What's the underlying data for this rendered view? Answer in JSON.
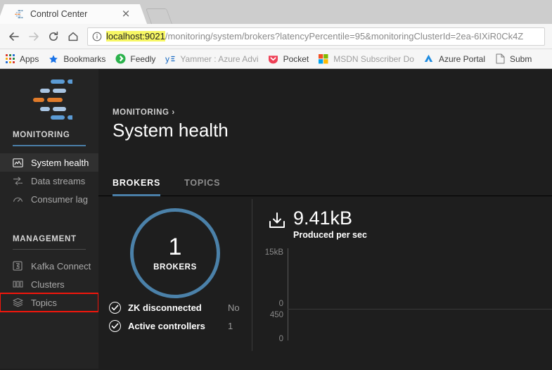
{
  "browser": {
    "tab": {
      "title": "Control Center",
      "favicon": "confluent-logo-icon",
      "close": "×"
    },
    "new_tab_label": "new-tab",
    "nav": {
      "back": "←",
      "forward": "→",
      "reload": "↻",
      "home": "⌂"
    },
    "omnibox": {
      "info_icon": "info-circle-icon",
      "host": "localhost:9021",
      "path": "/monitoring/system/brokers?latencyPercentile=95&monitoringClusterId=2ea-6IXiR0Ck4Z"
    },
    "bookmarks": [
      {
        "label": "Apps",
        "icon": "apps-grid-icon"
      },
      {
        "label": "Bookmarks",
        "icon": "star-icon"
      },
      {
        "label": "Feedly",
        "icon": "feedly-icon"
      },
      {
        "label": "Yammer : Azure Advi",
        "icon": "yammer-icon",
        "faded": true
      },
      {
        "label": "Pocket",
        "icon": "pocket-icon"
      },
      {
        "label": "MSDN Subscriber Do",
        "icon": "microsoft-icon",
        "faded": true
      },
      {
        "label": "Azure Portal",
        "icon": "azure-icon"
      },
      {
        "label": "Subm",
        "icon": "page-icon"
      }
    ]
  },
  "sidebar": {
    "logo": "confluent-control-center-logo",
    "sections": [
      {
        "title": "MONITORING",
        "accent": "#4a7fa8",
        "items": [
          {
            "label": "System health",
            "icon": "system-health-icon",
            "active": true
          },
          {
            "label": "Data streams",
            "icon": "data-streams-icon",
            "active": false
          },
          {
            "label": "Consumer lag",
            "icon": "consumer-lag-icon",
            "active": false
          }
        ]
      },
      {
        "title": "MANAGEMENT",
        "accent": "#4a4a4a",
        "items": [
          {
            "label": "Kafka Connect",
            "icon": "kafka-connect-icon",
            "active": false
          },
          {
            "label": "Clusters",
            "icon": "clusters-icon",
            "active": false
          },
          {
            "label": "Topics",
            "icon": "topics-icon",
            "active": false,
            "highlight": true
          }
        ]
      }
    ]
  },
  "main": {
    "breadcrumb": "MONITORING",
    "breadcrumb_chevron": "›",
    "title": "System health",
    "tabs": [
      {
        "label": "BROKERS",
        "selected": true
      },
      {
        "label": "TOPICS",
        "selected": false
      }
    ],
    "brokers_panel": {
      "gauge_value": "1",
      "gauge_label": "BROKERS",
      "statuses": [
        {
          "label": "ZK disconnected",
          "value": "No",
          "state": "ok"
        },
        {
          "label": "Active controllers",
          "value": "1",
          "state": "ok"
        }
      ]
    },
    "metric_panel": {
      "icon": "download-produced-icon",
      "value": "9.41kB",
      "subtitle": "Produced per sec"
    }
  },
  "chart_data": [
    {
      "type": "area",
      "title": "Produced per sec",
      "ylabel": "",
      "xlabel": "",
      "yticks": [
        "15kB",
        "0"
      ],
      "ylim": [
        0,
        15000
      ],
      "values": [],
      "grid": false,
      "legend": "none"
    },
    {
      "type": "area",
      "title": "",
      "ylabel": "",
      "xlabel": "",
      "yticks": [
        "450",
        "0"
      ],
      "ylim": [
        0,
        450
      ],
      "values": [],
      "grid": false,
      "legend": "none"
    }
  ],
  "colors": {
    "accent_blue": "#4a7fa8",
    "logo_orange": "#e8833a",
    "logo_blue": "#8fb4d9",
    "highlight_red": "#f2160c",
    "app_bg": "#1e1e1e",
    "sidebar_bg": "#242424",
    "url_highlight": "#f7f764"
  }
}
